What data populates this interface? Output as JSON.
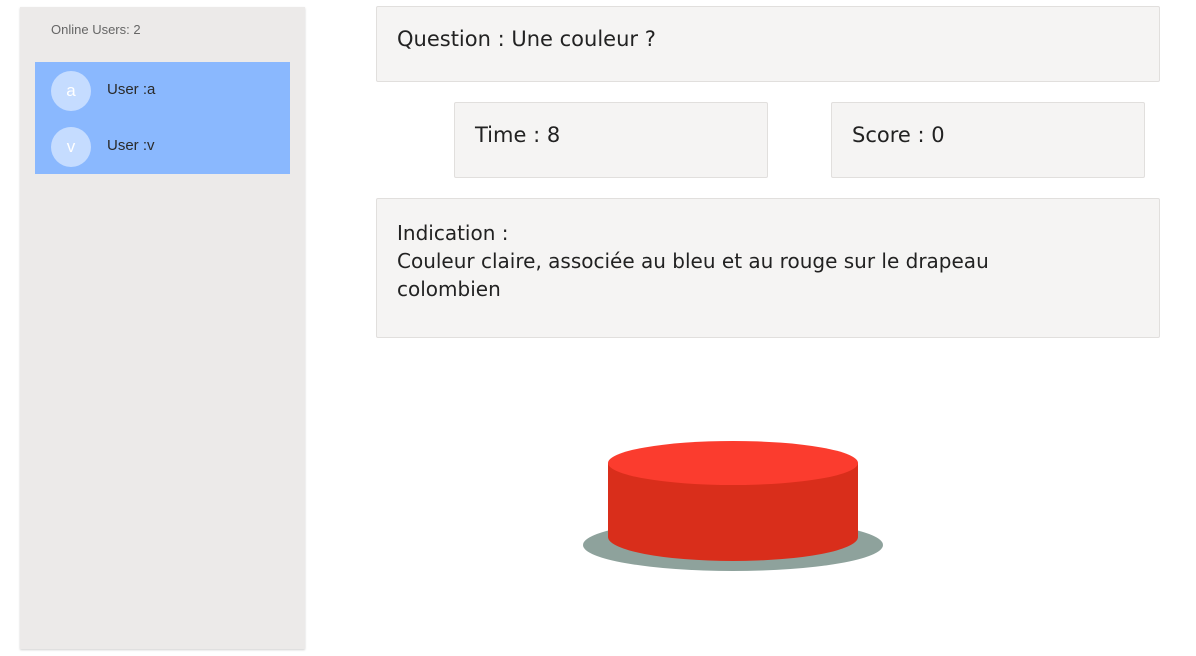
{
  "sidebar": {
    "online_label": "Online Users: 2",
    "users": [
      {
        "initial": "a",
        "name": "User :a"
      },
      {
        "initial": "v",
        "name": "User :v"
      }
    ]
  },
  "game": {
    "question": "Question : Une couleur ?",
    "time": "Time : 8",
    "score": "Score : 0",
    "hint_label": "Indication :",
    "hint_text": "Couleur claire, associée au bleu et au rouge sur le drapeau colombien"
  },
  "colors": {
    "user_list_bg": "#8ab8fe",
    "buzzer_top": "#fb3c2e",
    "buzzer_side": "#d92e1b",
    "buzzer_base": "#8ea29c"
  }
}
